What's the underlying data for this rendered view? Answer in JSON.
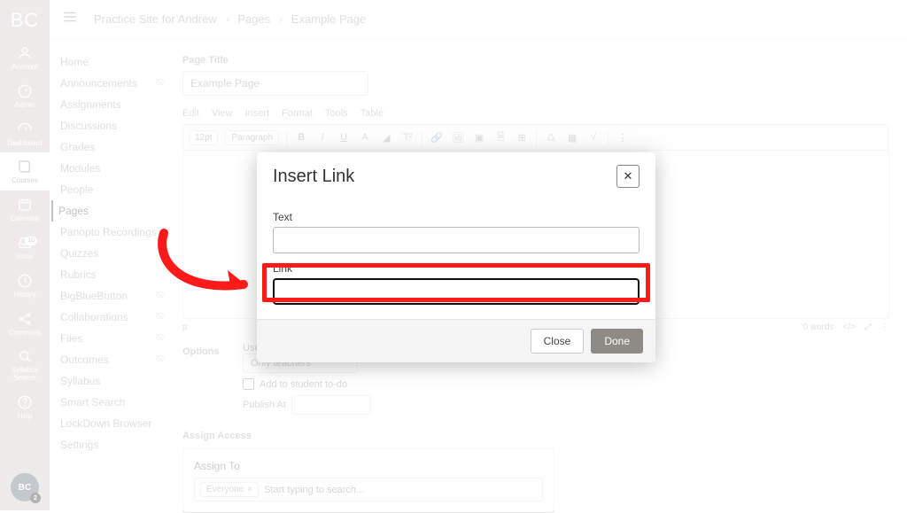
{
  "logo": "BC",
  "rail": [
    {
      "label": "Account",
      "icon": "user"
    },
    {
      "label": "Admin",
      "icon": "gauge"
    },
    {
      "label": "Dashboard",
      "icon": "speed"
    },
    {
      "label": "Courses",
      "icon": "book",
      "active": true
    },
    {
      "label": "Calendar",
      "icon": "cal"
    },
    {
      "label": "Inbox",
      "icon": "inbox",
      "badge": "10"
    },
    {
      "label": "History",
      "icon": "clock"
    },
    {
      "label": "Commons",
      "icon": "share"
    },
    {
      "label": "Syllabus Search",
      "icon": "search"
    },
    {
      "label": "Help",
      "icon": "help"
    }
  ],
  "avatar": {
    "text": "BC",
    "count": "2"
  },
  "crumb": {
    "a": "Practice Site for Andrew",
    "b": "Pages",
    "c": "Example Page"
  },
  "course_nav": [
    {
      "label": "Home"
    },
    {
      "label": "Announcements",
      "hidden": true
    },
    {
      "label": "Assignments"
    },
    {
      "label": "Discussions"
    },
    {
      "label": "Grades"
    },
    {
      "label": "Modules"
    },
    {
      "label": "People"
    },
    {
      "label": "Pages",
      "active": true
    },
    {
      "label": "Panopto Recordings"
    },
    {
      "label": "Quizzes"
    },
    {
      "label": "Rubrics"
    },
    {
      "label": "BigBlueButton",
      "hidden": true
    },
    {
      "label": "Collaborations",
      "hidden": true
    },
    {
      "label": "Files",
      "hidden": true
    },
    {
      "label": "Outcomes",
      "hidden": true
    },
    {
      "label": "Syllabus"
    },
    {
      "label": "Smart Search"
    },
    {
      "label": "LockDown Browser"
    },
    {
      "label": "Settings"
    }
  ],
  "page": {
    "title_label": "Page Title",
    "title_value": "Example Page",
    "menus": [
      "Edit",
      "View",
      "Insert",
      "Format",
      "Tools",
      "Table"
    ],
    "font_size": "12pt",
    "block": "Paragraph",
    "status_p": "p",
    "word_count": "0 words",
    "options_label": "Options",
    "users_label": "Users allowed to edit this page",
    "users_value": "Only teachers",
    "todo_label": "Add to student to-do",
    "publish_label": "Publish At",
    "assign_section": "Assign Access",
    "assign_to_label": "Assign To",
    "assign_tag": "Everyone",
    "assign_placeholder": "Start typing to search..."
  },
  "modal": {
    "title": "Insert Link",
    "text_label": "Text",
    "link_label": "Link",
    "text_value": "",
    "link_value": "",
    "close_btn": "Close",
    "done_btn": "Done"
  }
}
